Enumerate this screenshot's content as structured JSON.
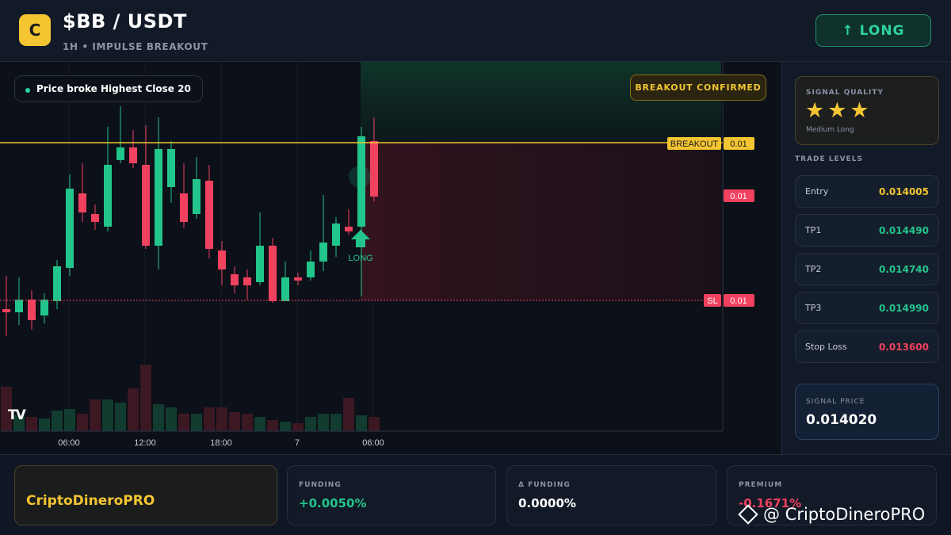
{
  "header": {
    "logo_letter": "C",
    "pair": "$BB / USDT",
    "subtitle": "1H • IMPULSE BREAKOUT",
    "long_button": "↑ LONG"
  },
  "chart": {
    "pill_text": "Price broke Highest Close 20",
    "confirmed_badge": "BREAKOUT CONFIRMED",
    "breakout_tag": "BREAKOUT",
    "breakout_value": "0.01",
    "entry_value": "0.01",
    "sl_tag": "SL",
    "sl_value": "0.01",
    "signal_label": "LONG",
    "tv_logo": "TV",
    "colors": {
      "up": "#22c58b",
      "down": "#f0415f",
      "breakout": "#f3c531"
    }
  },
  "chart_data": {
    "type": "candlestick",
    "x_ticks": [
      "06:00",
      "12:00",
      "18:00",
      "7",
      "06:00"
    ]
  },
  "side": {
    "signal_quality_title": "SIGNAL QUALITY",
    "stars": "★★★",
    "stars_value": 3,
    "signal_quality_sub": "Medium Long",
    "trade_levels_title": "TRADE LEVELS",
    "levels": [
      {
        "label": "Entry",
        "value": "0.014005",
        "color": "#f3c531"
      },
      {
        "label": "TP1",
        "value": "0.014490",
        "color": "#22c58b"
      },
      {
        "label": "TP2",
        "value": "0.014740",
        "color": "#22c58b"
      },
      {
        "label": "TP3",
        "value": "0.014990",
        "color": "#22c58b"
      },
      {
        "label": "Stop Loss",
        "value": "0.013600",
        "color": "#f0415f"
      }
    ],
    "signal_price_title": "SIGNAL PRICE",
    "signal_price": "0.014020"
  },
  "footer": {
    "brand": "CriptoDineroPRO",
    "stats": [
      {
        "title": "FUNDING",
        "value": "+0.0050%",
        "color": "#22c58b"
      },
      {
        "title": "Δ FUNDING",
        "value": "0.0000%",
        "color": "#ffffff"
      },
      {
        "title": "PREMIUM",
        "value": "-0.1671%",
        "color": "#f0415f"
      }
    ],
    "watermark": "@ CriptoDineroPRO"
  }
}
